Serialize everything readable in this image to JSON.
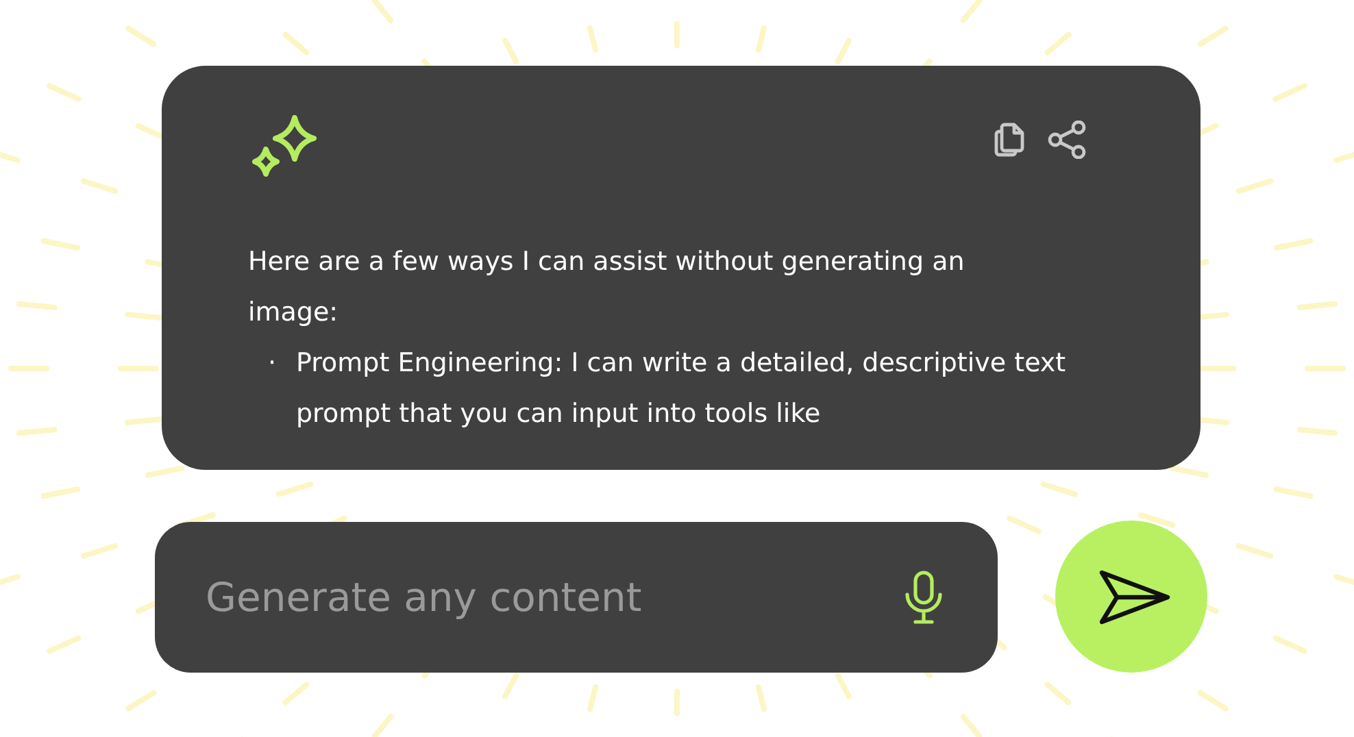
{
  "response": {
    "intro": "Here are a few ways I can assist without generating an image:",
    "bullets": [
      {
        "marker": "·",
        "text": "Prompt Engineering: I can write a detailed, descriptive text prompt that you can input into tools like"
      }
    ]
  },
  "composer": {
    "placeholder": "Generate any content"
  }
}
